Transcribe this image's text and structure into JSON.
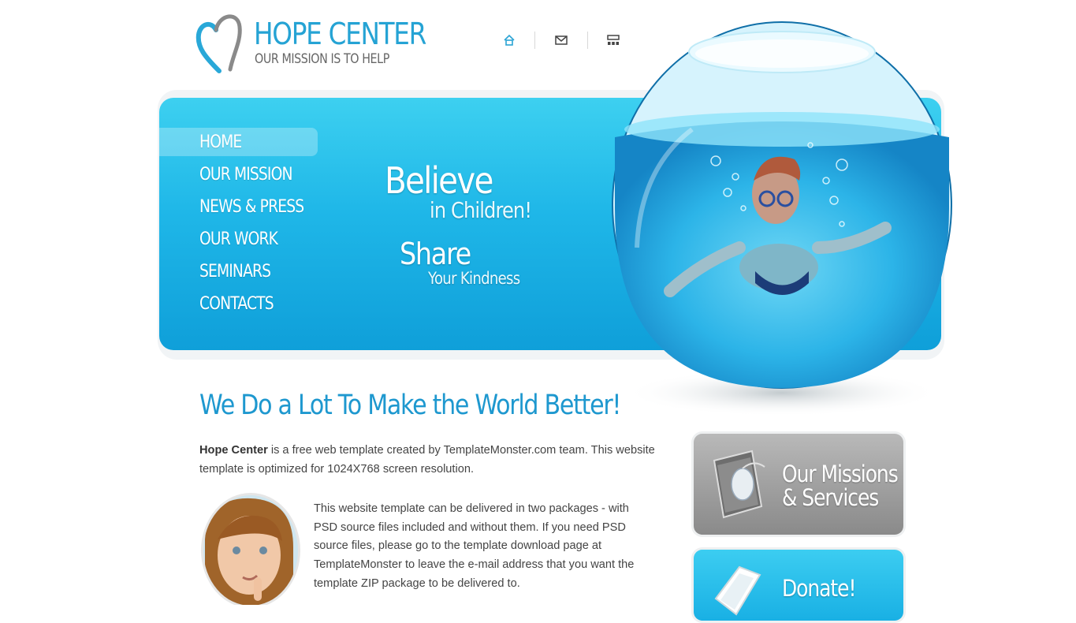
{
  "header": {
    "title": "HOPE CENTER",
    "tagline": "OUR MISSION IS TO HELP",
    "icons": [
      "home-icon",
      "mail-icon",
      "sitemap-icon"
    ]
  },
  "nav": {
    "items": [
      {
        "label": "HOME",
        "active": true
      },
      {
        "label": "OUR MISSION",
        "active": false
      },
      {
        "label": "NEWS & PRESS",
        "active": false
      },
      {
        "label": "OUR WORK",
        "active": false
      },
      {
        "label": "SEMINARS",
        "active": false
      },
      {
        "label": "CONTACTS",
        "active": false
      }
    ]
  },
  "banner": {
    "line1": "Believe",
    "line2": "in Children!",
    "line3": "Share",
    "line4": "Your Kindness"
  },
  "main": {
    "headline": "We Do a Lot To Make the World Better!",
    "intro_bold": "Hope Center",
    "intro_rest": " is a free web template created by TemplateMonster.com team. This website template is optimized for 1024X768 screen resolution.",
    "body": "This website template can be delivered in two packages - with PSD source files included and without them. If you need PSD source files, please go to the template download page at TemplateMonster to leave the e-mail address that you want the template ZIP package to be delivered to."
  },
  "sidebar": {
    "missions_line1": "Our Missions",
    "missions_line2": "& Services",
    "donate_label": "Donate!"
  },
  "colors": {
    "brand_blue": "#25a3d4",
    "banner_blue": "#1fb7e8",
    "text": "#444444"
  }
}
